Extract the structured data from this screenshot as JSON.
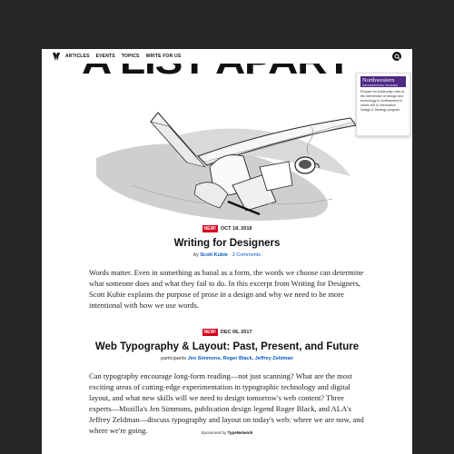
{
  "nav": {
    "items": [
      "ARTICLES",
      "EVENTS",
      "TOPICS",
      "WRITE FOR US"
    ]
  },
  "masthead": {
    "title": "A LIST APART"
  },
  "ad": {
    "brand": "Northwestern",
    "unit": "PROFESSIONAL STUDIES",
    "text": "Prepare for leadership roles at the intersection of design and technology in Northwestern's online MS in Information Design & Strategy program."
  },
  "articles": [
    {
      "badge": "NEW!",
      "date": "OCT 18, 2018",
      "title": "Writing for Designers",
      "byline_prefix": "by",
      "author": "Scott Kubie",
      "separator": "·",
      "comments": "2 Comments",
      "summary": "Words matter. Even in something as banal as a form, the words we choose can determine what someone does and what they fail to do. In this excerpt from Writing for Designers, Scott Kubie explains the purpose of prose in a design and why we need to be more intentional with how we use words."
    },
    {
      "badge": "NEW!",
      "date": "DEC 06, 2017",
      "title": "Web Typography & Layout: Past, Present, and Future",
      "byline_prefix": "participants",
      "participants": [
        "Jen Simmons,",
        "Roger Black,",
        "Jeffrey Zeldman"
      ],
      "summary": "Can typography encourage long-form reading—not just scanning? What are the most exciting areas of cutting-edge experimentation in typographic technology and digital layout, and what new skills will we need to design tomorrow's web content? Three experts—Mozilla's Jen Simmons, publication design legend Roger Black, and ALA's Jeffrey Zeldman—discuss typography and layout on today's web: where we are now, and where we're going."
    }
  ],
  "sponsor": {
    "prefix": "Sponsored by",
    "name": "TypeNetwork"
  },
  "colors": {
    "badge": "#d6001c",
    "link": "#0a58c2",
    "ad_brand": "#4e2a84",
    "backdrop": "#262626"
  }
}
